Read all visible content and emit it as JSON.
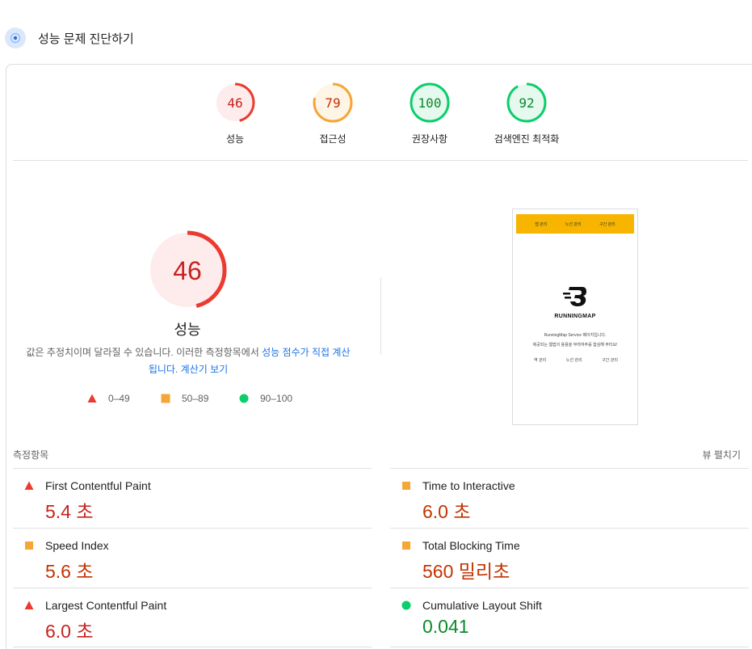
{
  "section_title": "성능 문제 진단하기",
  "categories": [
    {
      "label": "성능",
      "score": "46",
      "value": 46,
      "level": "fail"
    },
    {
      "label": "접근성",
      "score": "79",
      "value": 79,
      "level": "average"
    },
    {
      "label": "권장사항",
      "score": "100",
      "value": 100,
      "level": "pass"
    },
    {
      "label": "검색엔진 최적화",
      "score": "92",
      "value": 92,
      "level": "pass"
    }
  ],
  "main_score": {
    "score": "46",
    "value": 46,
    "label": "성능"
  },
  "description": {
    "text": "값은 추정치이며 달라질 수 있습니다. 이러한 측정항목에서 ",
    "link1": "성능 점수가 직접 계산됩니다",
    "sep": ". ",
    "link2": "계산기 보기"
  },
  "legend": [
    {
      "range": "0–49",
      "shape": "triangle"
    },
    {
      "range": "50–89",
      "shape": "square"
    },
    {
      "range": "90–100",
      "shape": "circle"
    }
  ],
  "screenshot": {
    "nav": [
      "맵 관리",
      "노선 관리",
      "구간 관리"
    ],
    "brand": "RUNNINGMAP",
    "line1": "RunningMap Service 페이지입니다.",
    "line2": "제공되는 웹앱의 용용을 무려여주를 합심해 부타요!",
    "links": [
      "역 관리",
      "노선 관리",
      "구간 관리"
    ]
  },
  "metrics_title": "측정항목",
  "expand_label": "뷰 펼치기",
  "metrics": [
    {
      "name": "First Contentful Paint",
      "value": "5.4 초",
      "level": "fail"
    },
    {
      "name": "Time to Interactive",
      "value": "6.0 초",
      "level": "average"
    },
    {
      "name": "Speed Index",
      "value": "5.6 초",
      "level": "average"
    },
    {
      "name": "Total Blocking Time",
      "value": "560 밀리초",
      "level": "average"
    },
    {
      "name": "Largest Contentful Paint",
      "value": "6.0 초",
      "level": "fail"
    },
    {
      "name": "Cumulative Layout Shift",
      "value": "0.041",
      "level": "pass"
    }
  ],
  "colors": {
    "fail": "#eb3b30",
    "fail_text": "#c7221f",
    "fail_bg": "#fdeceb",
    "average": "#f4a636",
    "average_text": "#c33300",
    "average_bg": "#fff5e6",
    "pass": "#0cce6b",
    "pass_text": "#0a8a2a",
    "pass_bg": "#e6f9ef",
    "link": "#1a73e8"
  }
}
